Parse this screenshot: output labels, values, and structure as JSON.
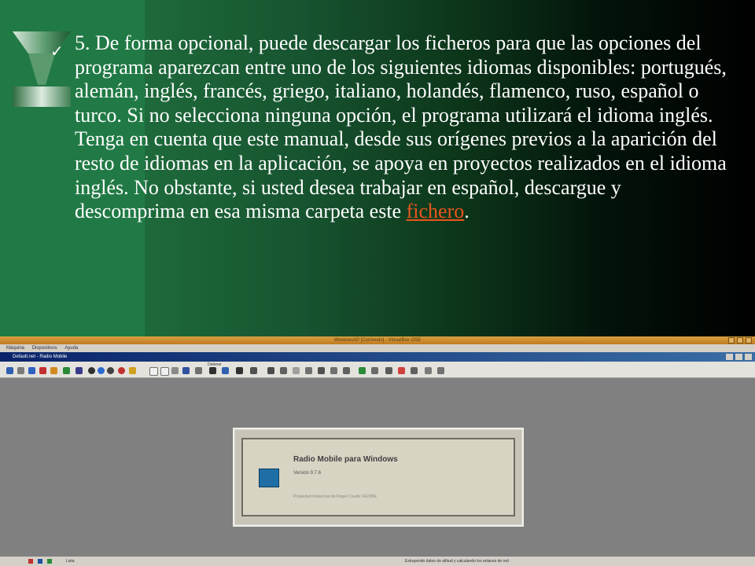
{
  "slide": {
    "bullet_glyph": "✓",
    "text_before_link": "5. De forma opcional, puede descargar los ficheros para que las opciones del programa aparezcan entre uno de los siguientes idiomas disponibles: portugués, alemán, inglés, francés, griego, italiano, holandés, flamenco, ruso, español o turco. Si no selecciona ninguna opción, el programa utilizará el idioma inglés. Tenga en cuenta que este manual, desde sus orígenes previos a la aparición del resto de idiomas en la aplicación, se apoya en proyectos realizados en el idioma inglés. No obstante, si usted desea trabajar en español, descargue y descomprima en esa misma carpeta este ",
    "link_text": "fichero",
    "text_after_link": ".",
    "link_color": "#e8561c"
  },
  "app": {
    "window_title": "WindowsXP [Corriendo] - VirtualBox OSE",
    "menu": [
      "Máquina",
      "Dispositivos",
      "Ayuda"
    ],
    "document_title": "Default.net - Radio Mobile",
    "toolbar_label": "Detener",
    "splash": {
      "title": "Radio Mobile para Windows",
      "version": "Versión 9.7.6",
      "owner": "Propiedad intelectual de Roger Coudé VE2DBE"
    },
    "status_left": "Lista",
    "status_right": "Extrayendo datos de altitud y calculando los enlaces de red"
  }
}
